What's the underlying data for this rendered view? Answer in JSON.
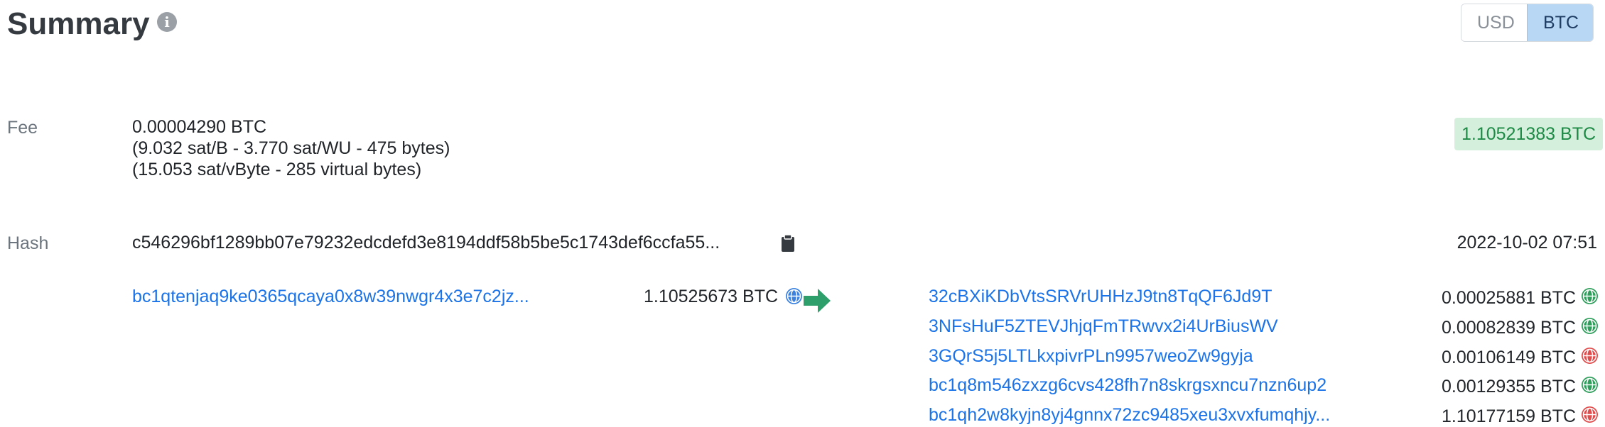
{
  "header": {
    "title": "Summary",
    "info_icon": "info-icon",
    "currency_options": [
      "USD",
      "BTC"
    ],
    "currency_selected": "BTC"
  },
  "fee": {
    "label": "Fee",
    "btc": "0.00004290 BTC",
    "rate_line": "(9.032 sat/B - 3.770 sat/WU - 475 bytes)",
    "vbyte_line": "(15.053 sat/vByte - 285 virtual bytes)",
    "total_badge": "1.10521383 BTC"
  },
  "hash": {
    "label": "Hash",
    "value": "c546296bf1289bb07e79232edcdefd3e8194ddf58b5be5c1743def6ccfa55...",
    "copy_icon": "clipboard-icon",
    "timestamp": "2022-10-02 07:51"
  },
  "inputs": [
    {
      "address": "bc1qtenjaq9ke0365qcaya0x8w39nwgr4x3e7c2jz...",
      "amount": "1.10525673 BTC",
      "icon": "globe-icon",
      "status": "blue"
    }
  ],
  "outputs": [
    {
      "address": "32cBXiKDbVtsSRVrUHHzJ9tn8TqQF6Jd9T",
      "amount": "0.00025881 BTC",
      "icon": "globe-icon",
      "status": "green"
    },
    {
      "address": "3NFsHuF5ZTEVJhjqFmTRwvx2i4UrBiusWV",
      "amount": "0.00082839 BTC",
      "icon": "globe-icon",
      "status": "green"
    },
    {
      "address": "3GQrS5j5LTLkxpivrPLn9957weoZw9gyja",
      "amount": "0.00106149 BTC",
      "icon": "globe-icon",
      "status": "red"
    },
    {
      "address": "bc1q8m546zxzg6cvs428fh7n8skrgsxncu7nzn6up2",
      "amount": "0.00129355 BTC",
      "icon": "globe-icon",
      "status": "green"
    },
    {
      "address": "bc1qh2w8kyjn8yj4gnnx72zc9485xeu3xvxfumqhjy...",
      "amount": "1.10177159 BTC",
      "icon": "globe-icon",
      "status": "red"
    }
  ],
  "colors": {
    "link": "#1a73e8",
    "arrow": "#2e9e6b",
    "badge_bg": "#d4f0dc",
    "badge_text": "#1e8a46",
    "spent": "#2e9e5b",
    "unspent": "#e04b4b"
  }
}
